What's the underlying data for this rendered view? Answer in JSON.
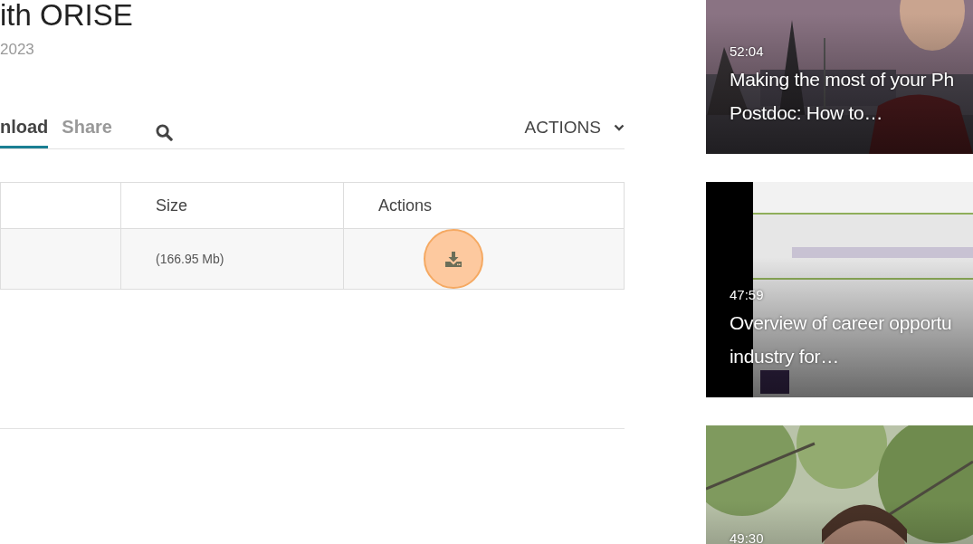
{
  "page": {
    "title": "ith ORISE",
    "date": "2023"
  },
  "tabs": [
    {
      "label": "nload",
      "selected": true
    },
    {
      "label": "Share",
      "selected": false
    }
  ],
  "actions_menu": {
    "label": "ACTIONS"
  },
  "table": {
    "columns": [
      "Size",
      "Actions"
    ],
    "rows": [
      {
        "size": "(166.95 Mb)"
      }
    ]
  },
  "videos": [
    {
      "duration": "52:04",
      "title_lines": [
        "Making the most of your Ph",
        "Postdoc: How to…"
      ],
      "kind": "picture"
    },
    {
      "duration": "47:59",
      "title_lines": [
        "Overview of career opportu",
        "industry for…"
      ],
      "kind": "picture"
    },
    {
      "duration": "49:30",
      "kind": "picture"
    }
  ]
}
